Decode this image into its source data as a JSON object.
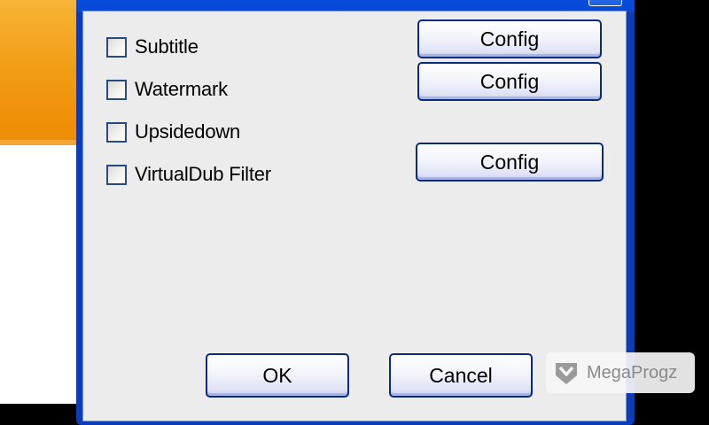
{
  "dialog": {
    "options": [
      {
        "label": "Subtitle",
        "checked": false
      },
      {
        "label": "Watermark",
        "checked": false
      },
      {
        "label": "Upsidedown",
        "checked": false
      },
      {
        "label": "VirtualDub Filter",
        "checked": false
      }
    ],
    "config_label": "Config",
    "ok_label": "OK",
    "cancel_label": "Cancel"
  },
  "watermark": {
    "text": "MegaProgz"
  },
  "colors": {
    "titlebar": "#0a4fdc",
    "dialog_bg": "#ececec",
    "background_accent": "#f19a12"
  }
}
